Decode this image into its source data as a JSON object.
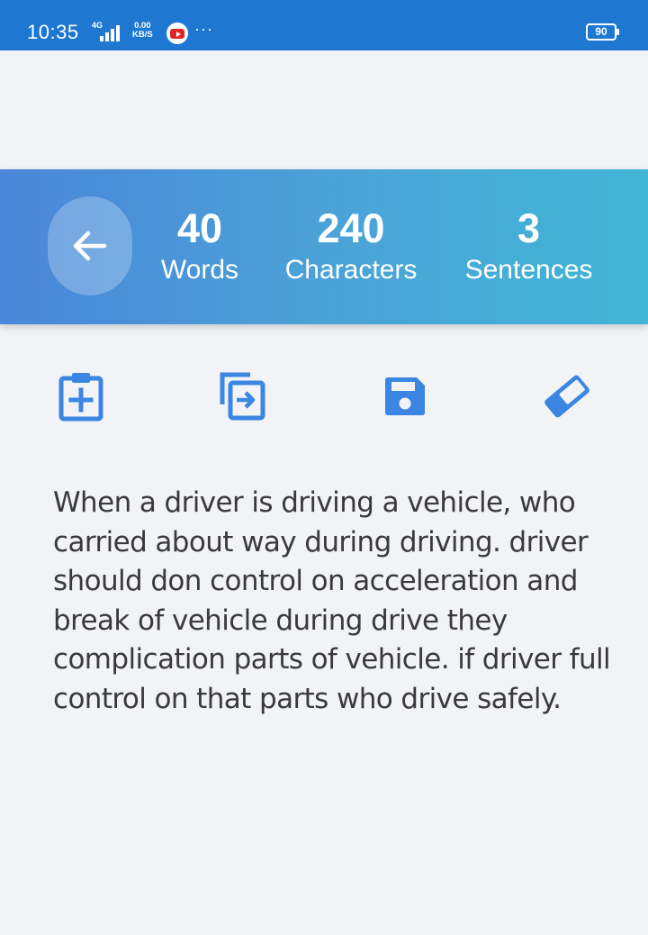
{
  "status_bar": {
    "time": "10:35",
    "network": "4G",
    "speed_top": "0.00",
    "speed_bottom": "KB/S",
    "more": "···",
    "battery": "90"
  },
  "stats": {
    "words_value": "40",
    "words_label": "Words",
    "chars_value": "240",
    "chars_label": "Characters",
    "sentences_value": "3",
    "sentences_label": "Sentences"
  },
  "toolbar": {
    "icons": [
      "clipboard-add-icon",
      "copy-icon",
      "save-icon",
      "eraser-icon"
    ]
  },
  "content": {
    "text": "When a driver is driving a vehicle, who carried about way during driving. driver should don control on acceleration and break of vehicle during drive they complication parts of vehicle. if driver full control on that parts who drive safely."
  },
  "colors": {
    "status_bar": "#1e78d2",
    "banner_start": "#4a86d9",
    "banner_end": "#41b6d5",
    "icon_accent": "#3b86e2",
    "background": "#f1f3f7",
    "text": "#3a3a3a"
  }
}
